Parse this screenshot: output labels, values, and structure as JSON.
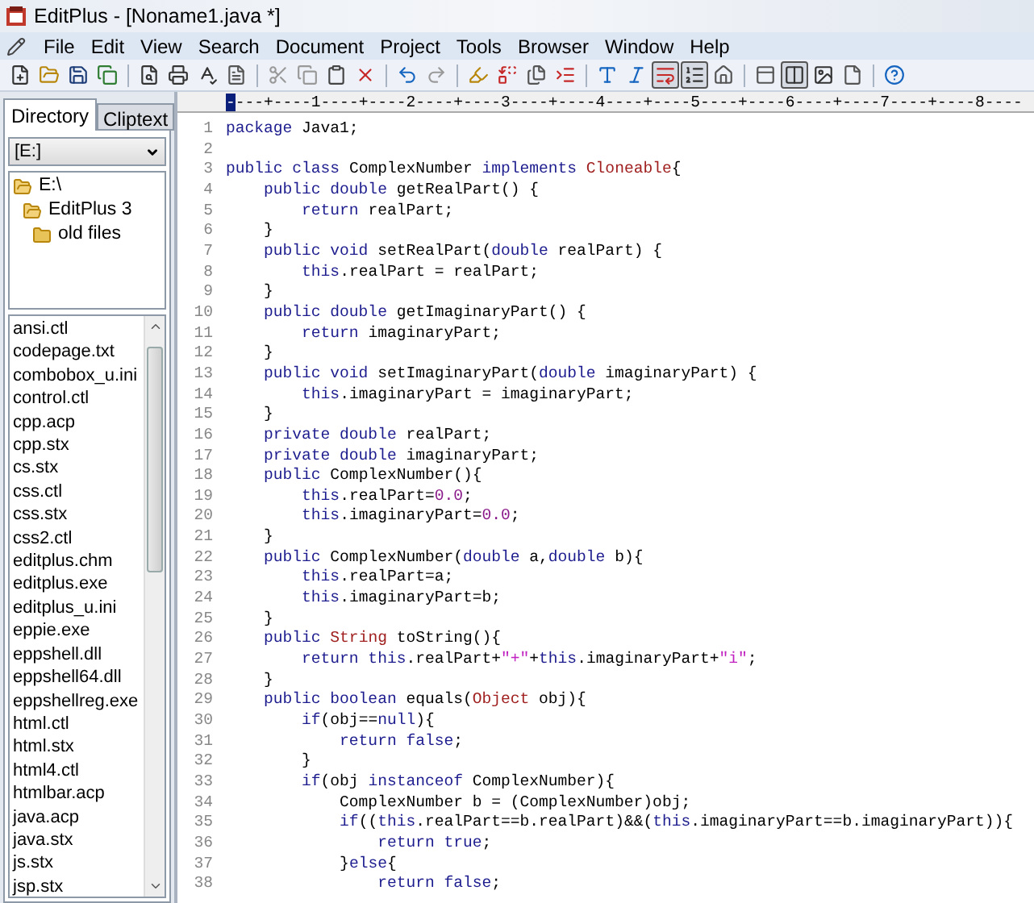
{
  "window": {
    "title": "EditPlus - [Noname1.java *]"
  },
  "menu": [
    "File",
    "Edit",
    "View",
    "Search",
    "Document",
    "Project",
    "Tools",
    "Browser",
    "Window",
    "Help"
  ],
  "toolbar": [
    {
      "kind": "button",
      "pressed": false
    },
    {
      "kind": "button",
      "pressed": false
    },
    {
      "kind": "button",
      "pressed": false
    },
    {
      "kind": "button",
      "pressed": false
    },
    {
      "kind": "separator"
    },
    {
      "kind": "button",
      "pressed": false
    },
    {
      "kind": "button",
      "pressed": false
    },
    {
      "kind": "button",
      "pressed": false
    },
    {
      "kind": "button",
      "pressed": false
    },
    {
      "kind": "separator"
    },
    {
      "kind": "button",
      "pressed": false
    },
    {
      "kind": "button",
      "pressed": false
    },
    {
      "kind": "button",
      "pressed": false
    },
    {
      "kind": "button",
      "pressed": false
    },
    {
      "kind": "separator"
    },
    {
      "kind": "button",
      "pressed": false
    },
    {
      "kind": "button",
      "pressed": false
    },
    {
      "kind": "separator"
    },
    {
      "kind": "button",
      "pressed": false
    },
    {
      "kind": "button",
      "pressed": false
    },
    {
      "kind": "button",
      "pressed": false
    },
    {
      "kind": "button",
      "pressed": false
    },
    {
      "kind": "separator"
    },
    {
      "kind": "button",
      "pressed": false
    },
    {
      "kind": "button",
      "pressed": false
    },
    {
      "kind": "button",
      "pressed": true
    },
    {
      "kind": "button",
      "pressed": true
    },
    {
      "kind": "button",
      "pressed": false
    },
    {
      "kind": "separator"
    },
    {
      "kind": "button",
      "pressed": false
    },
    {
      "kind": "button",
      "pressed": true
    },
    {
      "kind": "button",
      "pressed": false
    },
    {
      "kind": "button",
      "pressed": false
    },
    {
      "kind": "separator"
    },
    {
      "kind": "button",
      "pressed": false
    }
  ],
  "sidebar": {
    "tabs": [
      {
        "label": "Directory",
        "selected": true
      },
      {
        "label": "Cliptext",
        "selected": false
      }
    ],
    "drive": "[E:]",
    "tree": [
      {
        "label": "E:\\",
        "expanded": true,
        "children": [
          {
            "label": "EditPlus 3",
            "expanded": true,
            "children": [
              {
                "label": "old files",
                "expanded": false
              }
            ]
          }
        ]
      }
    ],
    "files": [
      "ansi.ctl",
      "codepage.txt",
      "combobox_u.ini",
      "control.ctl",
      "cpp.acp",
      "cpp.stx",
      "cs.stx",
      "css.ctl",
      "css.stx",
      "css2.ctl",
      "editplus.chm",
      "editplus.exe",
      "editplus_u.ini",
      "eppie.exe",
      "eppshell.dll",
      "eppshell64.dll",
      "eppshellreg.exe",
      "html.ctl",
      "html.stx",
      "html4.ctl",
      "htmlbar.acp",
      "java.acp",
      "java.stx",
      "js.stx",
      "jsp.stx"
    ]
  },
  "editor": {
    "ruler": "----+----1----+----2----+----3----+----4----+----5----+----6----+----7----+----8----",
    "lines": [
      {
        "number": "1",
        "tokens": [
          {
            "kind": "kw",
            "t": "package"
          },
          {
            "kind": "plain",
            "t": " Java1;"
          }
        ]
      },
      {
        "number": "2"
      },
      {
        "number": "3",
        "tokens": [
          {
            "kind": "kw",
            "t": "public class"
          },
          {
            "kind": "plain",
            "t": " ComplexNumber "
          },
          {
            "kind": "kw",
            "t": "implements"
          },
          {
            "kind": "type",
            "t": " Cloneable"
          },
          {
            "kind": "plain",
            "t": "{"
          }
        ]
      },
      {
        "number": "4",
        "tokens": [
          {
            "kind": "kw",
            "t": "    public double"
          },
          {
            "kind": "plain",
            "t": " getRealPart() {"
          }
        ]
      },
      {
        "number": "5",
        "tokens": [
          {
            "kind": "kw",
            "t": "        return"
          },
          {
            "kind": "plain",
            "t": " realPart;"
          }
        ]
      },
      {
        "number": "6",
        "tokens": [
          {
            "kind": "plain",
            "t": "    }"
          }
        ]
      },
      {
        "number": "7",
        "tokens": [
          {
            "kind": "kw",
            "t": "    public void"
          },
          {
            "kind": "plain",
            "t": " setRealPart("
          },
          {
            "kind": "kw",
            "t": "double"
          },
          {
            "kind": "plain",
            "t": " realPart) {"
          }
        ]
      },
      {
        "number": "8",
        "tokens": [
          {
            "kind": "kw",
            "t": "        this"
          },
          {
            "kind": "plain",
            "t": ".realPart = realPart;"
          }
        ]
      },
      {
        "number": "9",
        "tokens": [
          {
            "kind": "plain",
            "t": "    }"
          }
        ]
      },
      {
        "number": "10",
        "tokens": [
          {
            "kind": "kw",
            "t": "    public double"
          },
          {
            "kind": "plain",
            "t": " getImaginaryPart() {"
          }
        ]
      },
      {
        "number": "11",
        "tokens": [
          {
            "kind": "kw",
            "t": "        return"
          },
          {
            "kind": "plain",
            "t": " imaginaryPart;"
          }
        ]
      },
      {
        "number": "12",
        "tokens": [
          {
            "kind": "plain",
            "t": "    }"
          }
        ]
      },
      {
        "number": "13",
        "tokens": [
          {
            "kind": "kw",
            "t": "    public void"
          },
          {
            "kind": "plain",
            "t": " setImaginaryPart("
          },
          {
            "kind": "kw",
            "t": "double"
          },
          {
            "kind": "plain",
            "t": " imaginaryPart) {"
          }
        ]
      },
      {
        "number": "14",
        "tokens": [
          {
            "kind": "kw",
            "t": "        this"
          },
          {
            "kind": "plain",
            "t": ".imaginaryPart = imaginaryPart;"
          }
        ]
      },
      {
        "number": "15",
        "tokens": [
          {
            "kind": "plain",
            "t": "    }"
          }
        ]
      },
      {
        "number": "16",
        "tokens": [
          {
            "kind": "kw",
            "t": "    private double"
          },
          {
            "kind": "plain",
            "t": " realPart;"
          }
        ]
      },
      {
        "number": "17",
        "tokens": [
          {
            "kind": "kw",
            "t": "    private double"
          },
          {
            "kind": "plain",
            "t": " imaginaryPart;"
          }
        ]
      },
      {
        "number": "18",
        "tokens": [
          {
            "kind": "kw",
            "t": "    public"
          },
          {
            "kind": "plain",
            "t": " ComplexNumber(){"
          }
        ]
      },
      {
        "number": "19",
        "tokens": [
          {
            "kind": "kw",
            "t": "        this"
          },
          {
            "kind": "plain",
            "t": ".realPart="
          },
          {
            "kind": "num",
            "t": "0.0"
          },
          {
            "kind": "plain",
            "t": ";"
          }
        ]
      },
      {
        "number": "20",
        "tokens": [
          {
            "kind": "kw",
            "t": "        this"
          },
          {
            "kind": "plain",
            "t": ".imaginaryPart="
          },
          {
            "kind": "num",
            "t": "0.0"
          },
          {
            "kind": "plain",
            "t": ";"
          }
        ]
      },
      {
        "number": "21",
        "tokens": [
          {
            "kind": "plain",
            "t": "    }"
          }
        ]
      },
      {
        "number": "22",
        "tokens": [
          {
            "kind": "kw",
            "t": "    public"
          },
          {
            "kind": "plain",
            "t": " ComplexNumber("
          },
          {
            "kind": "kw",
            "t": "double"
          },
          {
            "kind": "plain",
            "t": " a,"
          },
          {
            "kind": "kw",
            "t": "double"
          },
          {
            "kind": "plain",
            "t": " b){"
          }
        ]
      },
      {
        "number": "23",
        "tokens": [
          {
            "kind": "kw",
            "t": "        this"
          },
          {
            "kind": "plain",
            "t": ".realPart=a;"
          }
        ]
      },
      {
        "number": "24",
        "tokens": [
          {
            "kind": "kw",
            "t": "        this"
          },
          {
            "kind": "plain",
            "t": ".imaginaryPart=b;"
          }
        ]
      },
      {
        "number": "25",
        "tokens": [
          {
            "kind": "plain",
            "t": "    }"
          }
        ]
      },
      {
        "number": "26",
        "tokens": [
          {
            "kind": "kw",
            "t": "    public"
          },
          {
            "kind": "type",
            "t": " String"
          },
          {
            "kind": "plain",
            "t": " toString(){"
          }
        ]
      },
      {
        "number": "27",
        "tokens": [
          {
            "kind": "kw",
            "t": "        return this"
          },
          {
            "kind": "plain",
            "t": ".realPart+"
          },
          {
            "kind": "str",
            "t": "\"+\""
          },
          {
            "kind": "plain",
            "t": "+"
          },
          {
            "kind": "kw",
            "t": "this"
          },
          {
            "kind": "plain",
            "t": ".imaginaryPart+"
          },
          {
            "kind": "str",
            "t": "\"i\""
          },
          {
            "kind": "plain",
            "t": ";"
          }
        ]
      },
      {
        "number": "28",
        "tokens": [
          {
            "kind": "plain",
            "t": "    }"
          }
        ]
      },
      {
        "number": "29",
        "tokens": [
          {
            "kind": "kw",
            "t": "    public boolean"
          },
          {
            "kind": "plain",
            "t": " equals("
          },
          {
            "kind": "type",
            "t": "Object"
          },
          {
            "kind": "plain",
            "t": " obj){"
          }
        ]
      },
      {
        "number": "30",
        "tokens": [
          {
            "kind": "kw",
            "t": "        if"
          },
          {
            "kind": "plain",
            "t": "(obj=="
          },
          {
            "kind": "kw",
            "t": "null"
          },
          {
            "kind": "plain",
            "t": "){"
          }
        ]
      },
      {
        "number": "31",
        "tokens": [
          {
            "kind": "kw",
            "t": "            return false"
          },
          {
            "kind": "plain",
            "t": ";"
          }
        ]
      },
      {
        "number": "32",
        "tokens": [
          {
            "kind": "plain",
            "t": "        }"
          }
        ]
      },
      {
        "number": "33",
        "tokens": [
          {
            "kind": "kw",
            "t": "        if"
          },
          {
            "kind": "plain",
            "t": "(obj "
          },
          {
            "kind": "kw",
            "t": "instanceof"
          },
          {
            "kind": "plain",
            "t": " ComplexNumber){"
          }
        ]
      },
      {
        "number": "34",
        "tokens": [
          {
            "kind": "plain",
            "t": "            ComplexNumber b = (ComplexNumber)obj;"
          }
        ]
      },
      {
        "number": "35",
        "tokens": [
          {
            "kind": "kw",
            "t": "            if"
          },
          {
            "kind": "plain",
            "t": "(("
          },
          {
            "kind": "kw",
            "t": "this"
          },
          {
            "kind": "plain",
            "t": ".realPart==b.realPart)&&("
          },
          {
            "kind": "kw",
            "t": "this"
          },
          {
            "kind": "plain",
            "t": ".imaginaryPart==b.imaginaryPart)){"
          }
        ]
      },
      {
        "number": "36",
        "tokens": [
          {
            "kind": "kw",
            "t": "                return true"
          },
          {
            "kind": "plain",
            "t": ";"
          }
        ]
      },
      {
        "number": "37",
        "tokens": [
          {
            "kind": "plain",
            "t": "            }"
          },
          {
            "kind": "kw",
            "t": "else"
          },
          {
            "kind": "plain",
            "t": "{"
          }
        ]
      },
      {
        "number": "38",
        "tokens": [
          {
            "kind": "kw",
            "t": "                return false"
          },
          {
            "kind": "plain",
            "t": ";"
          }
        ]
      }
    ]
  }
}
